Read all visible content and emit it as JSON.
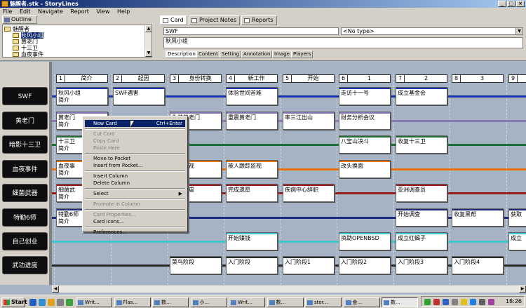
{
  "window": {
    "title": "魅醒者.stk - StoryLines"
  },
  "menu": [
    "File",
    "Edit",
    "Navigate",
    "Report",
    "View",
    "Help"
  ],
  "outline": {
    "tab": "Outline",
    "root": "魅醒者",
    "items": [
      "秋风小组",
      "黄老门",
      "十三卫",
      "血夜事件"
    ],
    "selected_index": 0
  },
  "toptabs": {
    "card": "Card",
    "project_notes": "Project Notes",
    "reports": "Reports"
  },
  "fields": {
    "title_value": "SWF",
    "type_value": "<No type>",
    "summary_value": "秋风小组"
  },
  "subtabs": [
    "Description",
    "Content",
    "Setting",
    "Annotation",
    "Image",
    "Players"
  ],
  "columns": [
    {
      "n": "1",
      "t": "简介"
    },
    {
      "n": "2",
      "t": "起因"
    },
    {
      "n": "3",
      "t": "身份转换"
    },
    {
      "n": "4",
      "t": "新工作"
    },
    {
      "n": "5",
      "t": "开始"
    },
    {
      "n": "6",
      "t": "1"
    },
    {
      "n": "7",
      "t": "2"
    },
    {
      "n": "8",
      "t": "3"
    },
    {
      "n": "9",
      "t": ""
    }
  ],
  "rows": [
    {
      "label": "SWF",
      "color": "#1a35a8"
    },
    {
      "label": "黄老门",
      "color": "#8a7ab8"
    },
    {
      "label": "暗影十三卫",
      "color": "#1e6e3c"
    },
    {
      "label": "血夜事件",
      "color": "#e8740e"
    },
    {
      "label": "细菌武器",
      "color": "#9b1a1a"
    },
    {
      "label": "特勤6师",
      "color": "#1e2a7a"
    },
    {
      "label": "自己创业",
      "color": "#3cc8d0"
    },
    {
      "label": "武功进度",
      "color": "#2a2a2a"
    }
  ],
  "cards": [
    {
      "r": 0,
      "c": 0,
      "t": "秋风小组",
      "s": "简介"
    },
    {
      "r": 0,
      "c": 1,
      "t": "SWF遇害",
      "s": ""
    },
    {
      "r": 0,
      "c": 3,
      "t": "体验世间苦难",
      "s": ""
    },
    {
      "r": 0,
      "c": 5,
      "t": "走访十一号",
      "s": ""
    },
    {
      "r": 0,
      "c": 6,
      "t": "成立基金会",
      "s": ""
    },
    {
      "r": 1,
      "c": 0,
      "t": "黄老门",
      "s": "简介"
    },
    {
      "r": 1,
      "c": 2,
      "t": "伪装黄老门",
      "s": ""
    },
    {
      "r": 1,
      "c": 3,
      "t": "重震黄老门",
      "s": ""
    },
    {
      "r": 1,
      "c": 4,
      "t": "率三江出山",
      "s": ""
    },
    {
      "r": 1,
      "c": 5,
      "t": "财务分析会议",
      "s": ""
    },
    {
      "r": 2,
      "c": 0,
      "t": "十三卫",
      "s": "简介"
    },
    {
      "r": 2,
      "c": 5,
      "t": "八宝山决斗",
      "s": ""
    },
    {
      "r": 2,
      "c": 6,
      "t": "收复十三卫",
      "s": ""
    },
    {
      "r": 3,
      "c": 0,
      "t": "血夜事",
      "s": "简介"
    },
    {
      "r": 3,
      "c": 2,
      "t": "被人监视",
      "s": ""
    },
    {
      "r": 3,
      "c": 3,
      "t": "被人跟踪监视",
      "s": ""
    },
    {
      "r": 3,
      "c": 5,
      "t": "改头换面",
      "s": ""
    },
    {
      "r": 4,
      "c": 0,
      "t": "细菌武",
      "s": "简介"
    },
    {
      "r": 4,
      "c": 2,
      "t": "武器肆虐",
      "s": ""
    },
    {
      "r": 4,
      "c": 3,
      "t": "完成遗愿",
      "s": ""
    },
    {
      "r": 4,
      "c": 4,
      "t": "疾病中心辞职",
      "s": ""
    },
    {
      "r": 4,
      "c": 6,
      "t": "亚洲调查员",
      "s": ""
    },
    {
      "r": 5,
      "c": 0,
      "t": "特勤6师",
      "s": "简介"
    },
    {
      "r": 5,
      "c": 6,
      "t": "开始调查",
      "s": ""
    },
    {
      "r": 5,
      "c": 7,
      "t": "收复黑帮",
      "s": ""
    },
    {
      "r": 5,
      "c": 8,
      "t": "获取",
      "s": ""
    },
    {
      "r": 6,
      "c": 3,
      "t": "开始赚钱",
      "s": ""
    },
    {
      "r": 6,
      "c": 5,
      "t": "资助OPENBSD",
      "s": ""
    },
    {
      "r": 6,
      "c": 6,
      "t": "成立红蝎子",
      "s": ""
    },
    {
      "r": 6,
      "c": 8,
      "t": "成立",
      "s": ""
    },
    {
      "r": 7,
      "c": 2,
      "t": "菜鸟阶段",
      "s": ""
    },
    {
      "r": 7,
      "c": 3,
      "t": "入门阶段",
      "s": ""
    },
    {
      "r": 7,
      "c": 4,
      "t": "入门阶段1",
      "s": ""
    },
    {
      "r": 7,
      "c": 5,
      "t": "入门阶段2",
      "s": ""
    },
    {
      "r": 7,
      "c": 6,
      "t": "入门阶段3",
      "s": ""
    },
    {
      "r": 7,
      "c": 7,
      "t": "入门阶段4",
      "s": ""
    }
  ],
  "context_menu": [
    {
      "label": "New Card",
      "shortcut": "Ctrl+Enter",
      "state": "highlight"
    },
    {
      "sep": true
    },
    {
      "label": "Cut Card",
      "state": "disabled"
    },
    {
      "label": "Copy Card",
      "state": "disabled"
    },
    {
      "label": "Paste Here",
      "state": "disabled"
    },
    {
      "sep": true
    },
    {
      "label": "Move to Pocket",
      "state": "normal"
    },
    {
      "label": "Insert from Pocket...",
      "state": "normal"
    },
    {
      "sep": true
    },
    {
      "label": "Insert Column",
      "state": "normal"
    },
    {
      "label": "Delete Column",
      "state": "normal"
    },
    {
      "sep": true
    },
    {
      "label": "Select",
      "state": "submenu"
    },
    {
      "sep": true
    },
    {
      "label": "Promote in Column",
      "state": "disabled"
    },
    {
      "sep": true
    },
    {
      "label": "Card Properties...",
      "state": "disabled"
    },
    {
      "label": "Card Icons...",
      "state": "normal"
    },
    {
      "sep": true
    },
    {
      "label": "Preferences...",
      "state": "normal"
    }
  ],
  "taskbar": {
    "start": "Start",
    "buttons": [
      "Writ...",
      "Flas...",
      "数...",
      "小...",
      "Writ...",
      "数...",
      "stor...",
      "金...",
      "数..."
    ],
    "active_index": 8,
    "clock": "18:26"
  }
}
